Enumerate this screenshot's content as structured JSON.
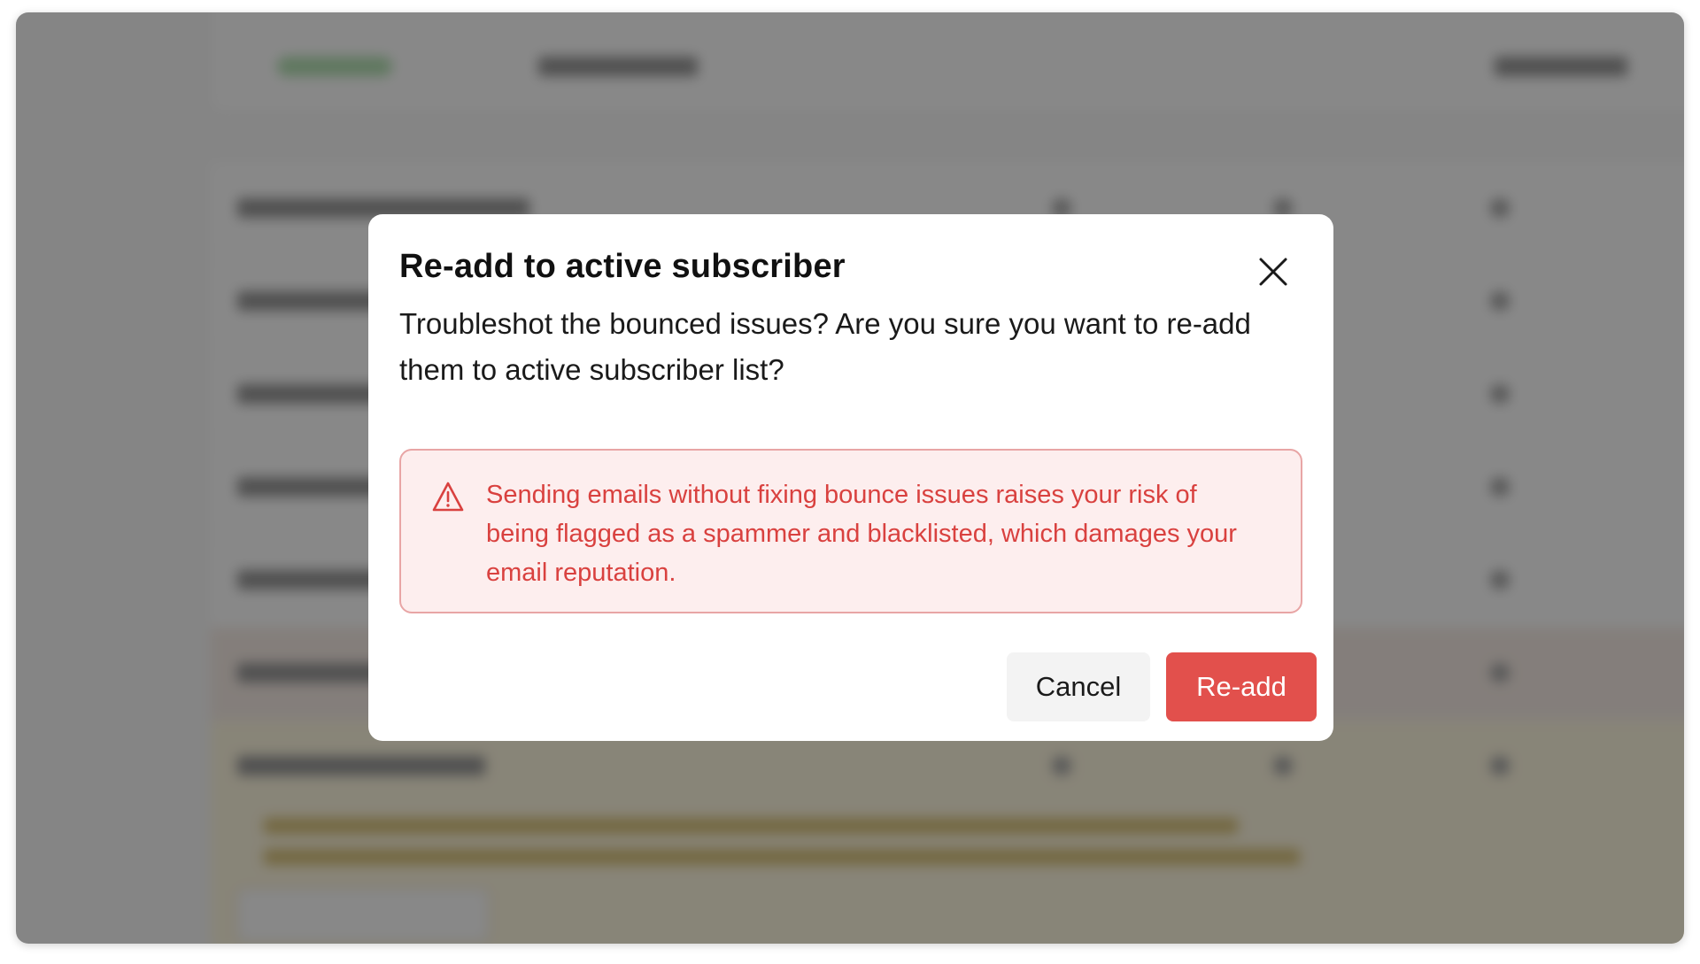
{
  "dialog": {
    "title": "Re-add to active subscriber",
    "message": "Troubleshot the bounced issues? Are you sure you want to re-add them to active subscriber list?",
    "warning": "Sending emails without fixing bounce issues raises your risk of being flagged as a spammer and blacklisted, which damages your email reputation.",
    "cancel_label": "Cancel",
    "confirm_label": "Re-add",
    "close_icon": "close-icon",
    "warning_icon": "warning-triangle-icon"
  },
  "colors": {
    "accent": "#e2504c",
    "warning_text": "#d9413f",
    "warning_bg": "#fdeeee",
    "warning_border": "#e8a5a5",
    "overlay": "rgba(90,90,90,0.72)"
  }
}
